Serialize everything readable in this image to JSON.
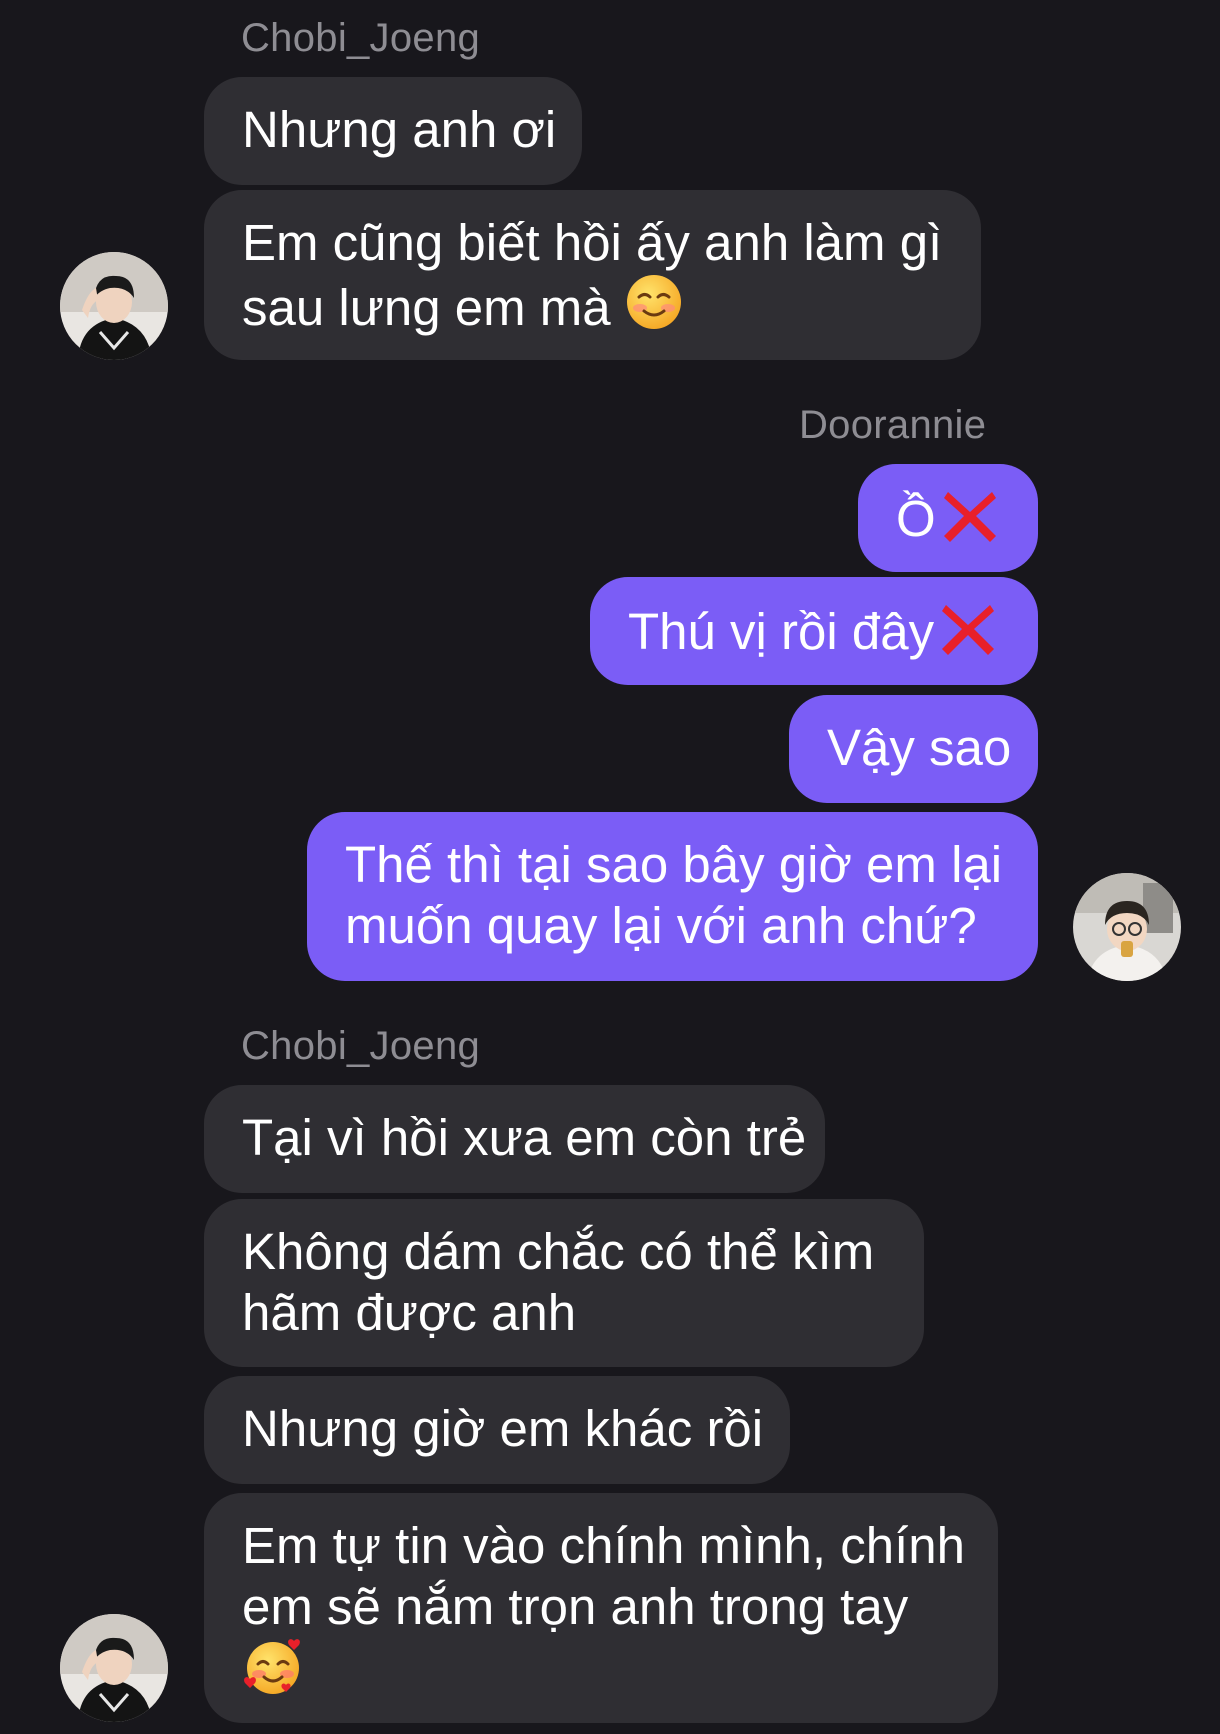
{
  "conversation": {
    "groups": [
      {
        "sender": "Chobi_Joeng",
        "messages": [
          {
            "text": "Nhưng anh ơi"
          },
          {
            "line1": "Em cũng biết hồi ấy anh làm gì",
            "line2": "sau lưng em mà",
            "emoji": "☺️"
          }
        ]
      },
      {
        "sender": "Doorannie",
        "messages": [
          {
            "text": "Ồ",
            "icon": "cross-mark-icon"
          },
          {
            "text": "Thú vị rồi đây",
            "icon": "cross-mark-icon"
          },
          {
            "text": "Vậy sao"
          },
          {
            "line1": "Thế thì tại sao bây giờ em lại",
            "line2": "muốn quay lại với anh chứ?"
          }
        ]
      },
      {
        "sender": "Chobi_Joeng",
        "messages": [
          {
            "text": "Tại vì hồi xưa em còn trẻ"
          },
          {
            "line1": "Không dám chắc có thể kìm",
            "line2": "hãm được anh"
          },
          {
            "text": "Nhưng giờ em khác rồi"
          },
          {
            "line1": "Em tự tin vào chính mình, chính",
            "line2": "em sẽ nắm trọn anh trong tay",
            "emoji": "🥰"
          }
        ]
      }
    ]
  },
  "colors": {
    "background": "#18171c",
    "incoming_bubble": "#2f2e33",
    "outgoing_bubble": "#7b5df6",
    "sender_name": "#8e8d93",
    "message_text": "#ffffff",
    "cross_mark": "#e8202a"
  }
}
